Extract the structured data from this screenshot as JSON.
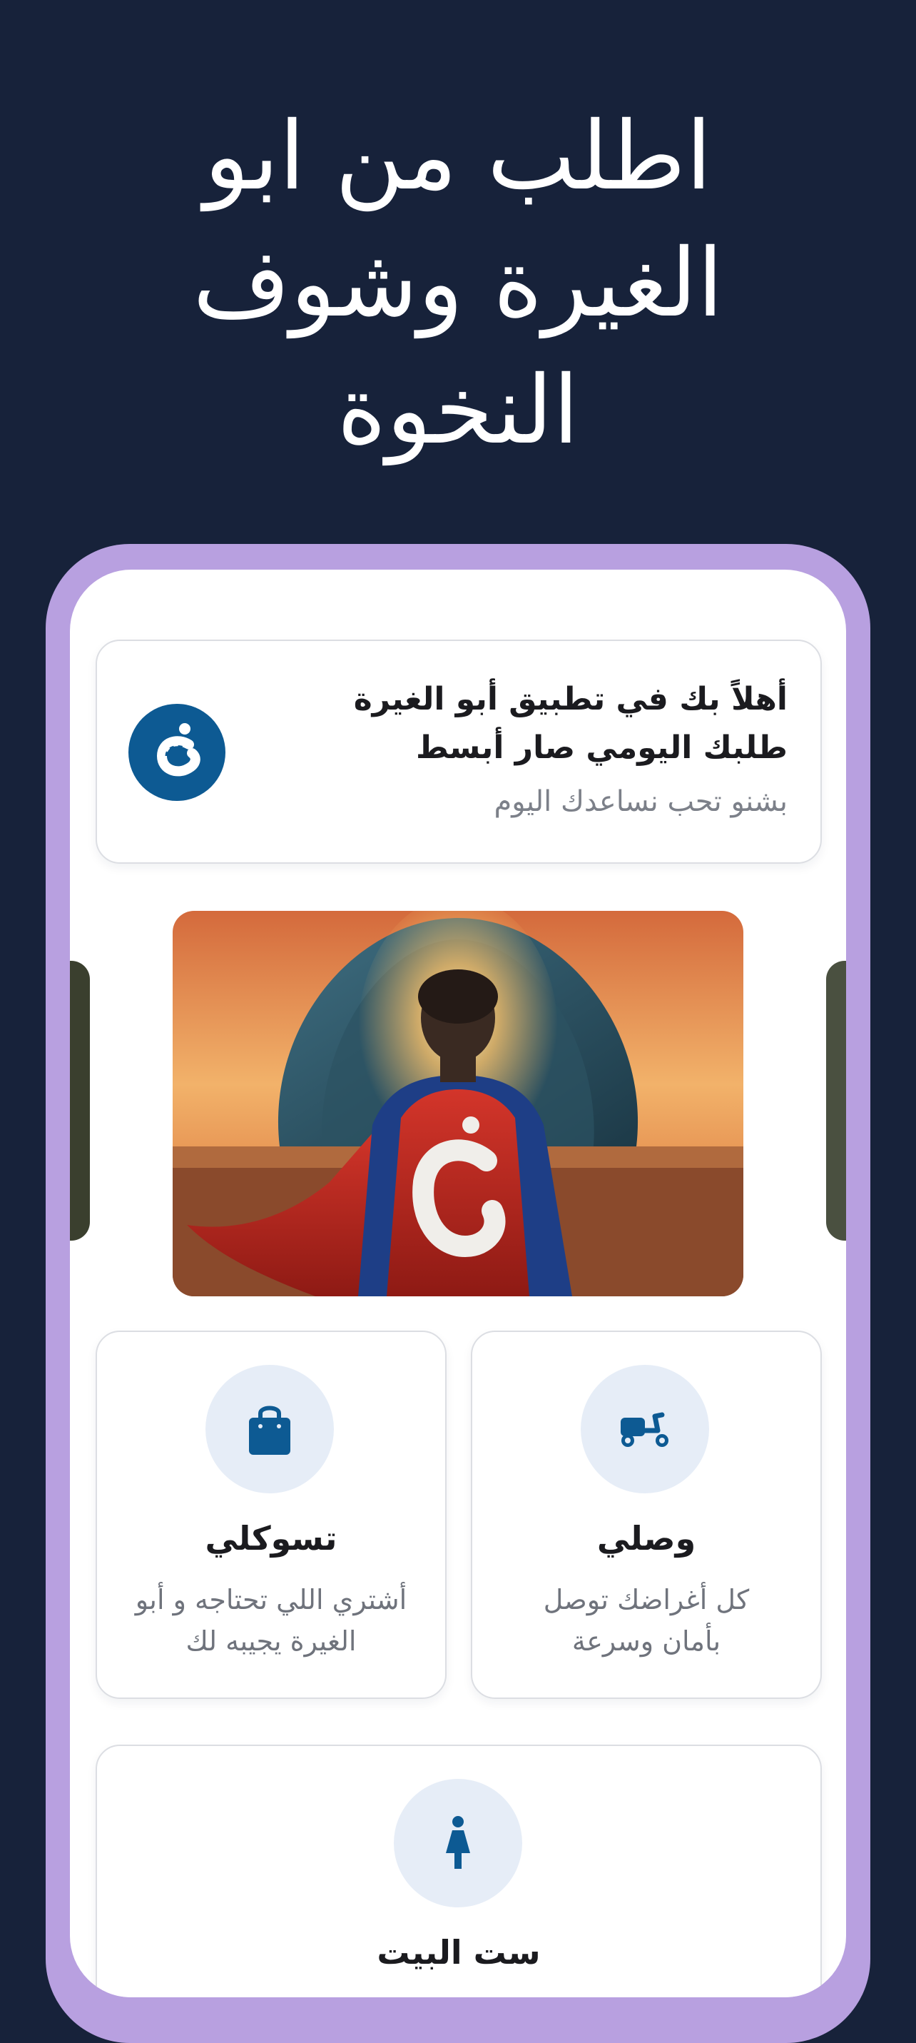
{
  "headline": {
    "line1": "اطلب من ابو",
    "line2": "الغيرة وشوف",
    "line3": "النخوة"
  },
  "welcome": {
    "title": "أهلاً بك في تطبيق أبو الغيرة طلبك اليومي صار أبسط",
    "subtitle": "بشنو تحب نساعدك اليوم"
  },
  "services": [
    {
      "title": "وصلي",
      "desc": "كل أغراضك توصل بأمان وسرعة",
      "icon": "scooter-icon"
    },
    {
      "title": "تسوكلي",
      "desc": "أشتري اللي تحتاجه و أبو الغيرة يجيبه لك",
      "icon": "shopping-bag-icon"
    },
    {
      "title": "ست البيت",
      "desc": "",
      "icon": "woman-icon"
    }
  ],
  "colors": {
    "background": "#17223a",
    "frame": "#b8a0e0",
    "accent": "#0d5a93",
    "icon_bg": "#e6edf7"
  }
}
